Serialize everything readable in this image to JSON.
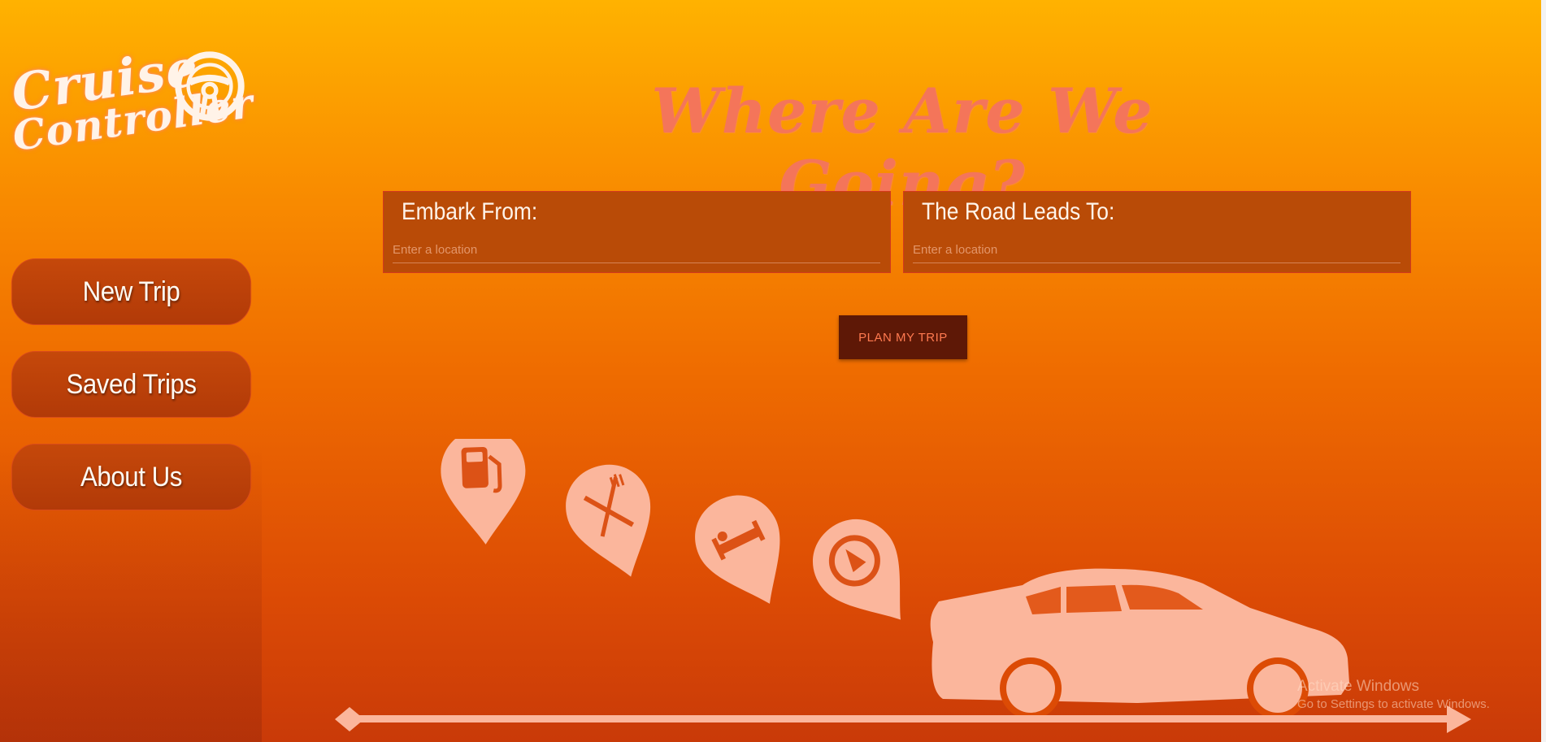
{
  "app": {
    "logo_text_line1": "Cruise",
    "logo_text_line2": "Controller",
    "logo_icon": "steering-wheel-icon"
  },
  "sidebar": {
    "items": [
      {
        "label": "New Trip"
      },
      {
        "label": "Saved Trips"
      },
      {
        "label": "About Us"
      }
    ]
  },
  "main": {
    "headline": "Where Are We Going?",
    "origin": {
      "label": "Embark From:",
      "placeholder": "Enter a location",
      "value": ""
    },
    "destination": {
      "label": "The Road Leads To:",
      "placeholder": "Enter a location",
      "value": ""
    },
    "plan_button": "PLAN MY TRIP"
  },
  "illustration": {
    "icons": [
      "gas-station-pin-icon",
      "restaurant-pin-icon",
      "hotel-pin-icon",
      "direction-pin-icon",
      "car-icon",
      "road-arrow-icon"
    ]
  },
  "watermark": {
    "title": "Activate Windows",
    "subtitle": "Go to Settings to activate Windows."
  },
  "colors": {
    "background_top": "#ffb200",
    "background_bottom": "#c93a08",
    "nav_button": "#b23a08",
    "headline": "#f4755a",
    "field_bg": "#b94b07",
    "plan_button_bg": "#5e1806",
    "plan_button_text": "#ff7a50",
    "illustration": "#fbb69c"
  }
}
